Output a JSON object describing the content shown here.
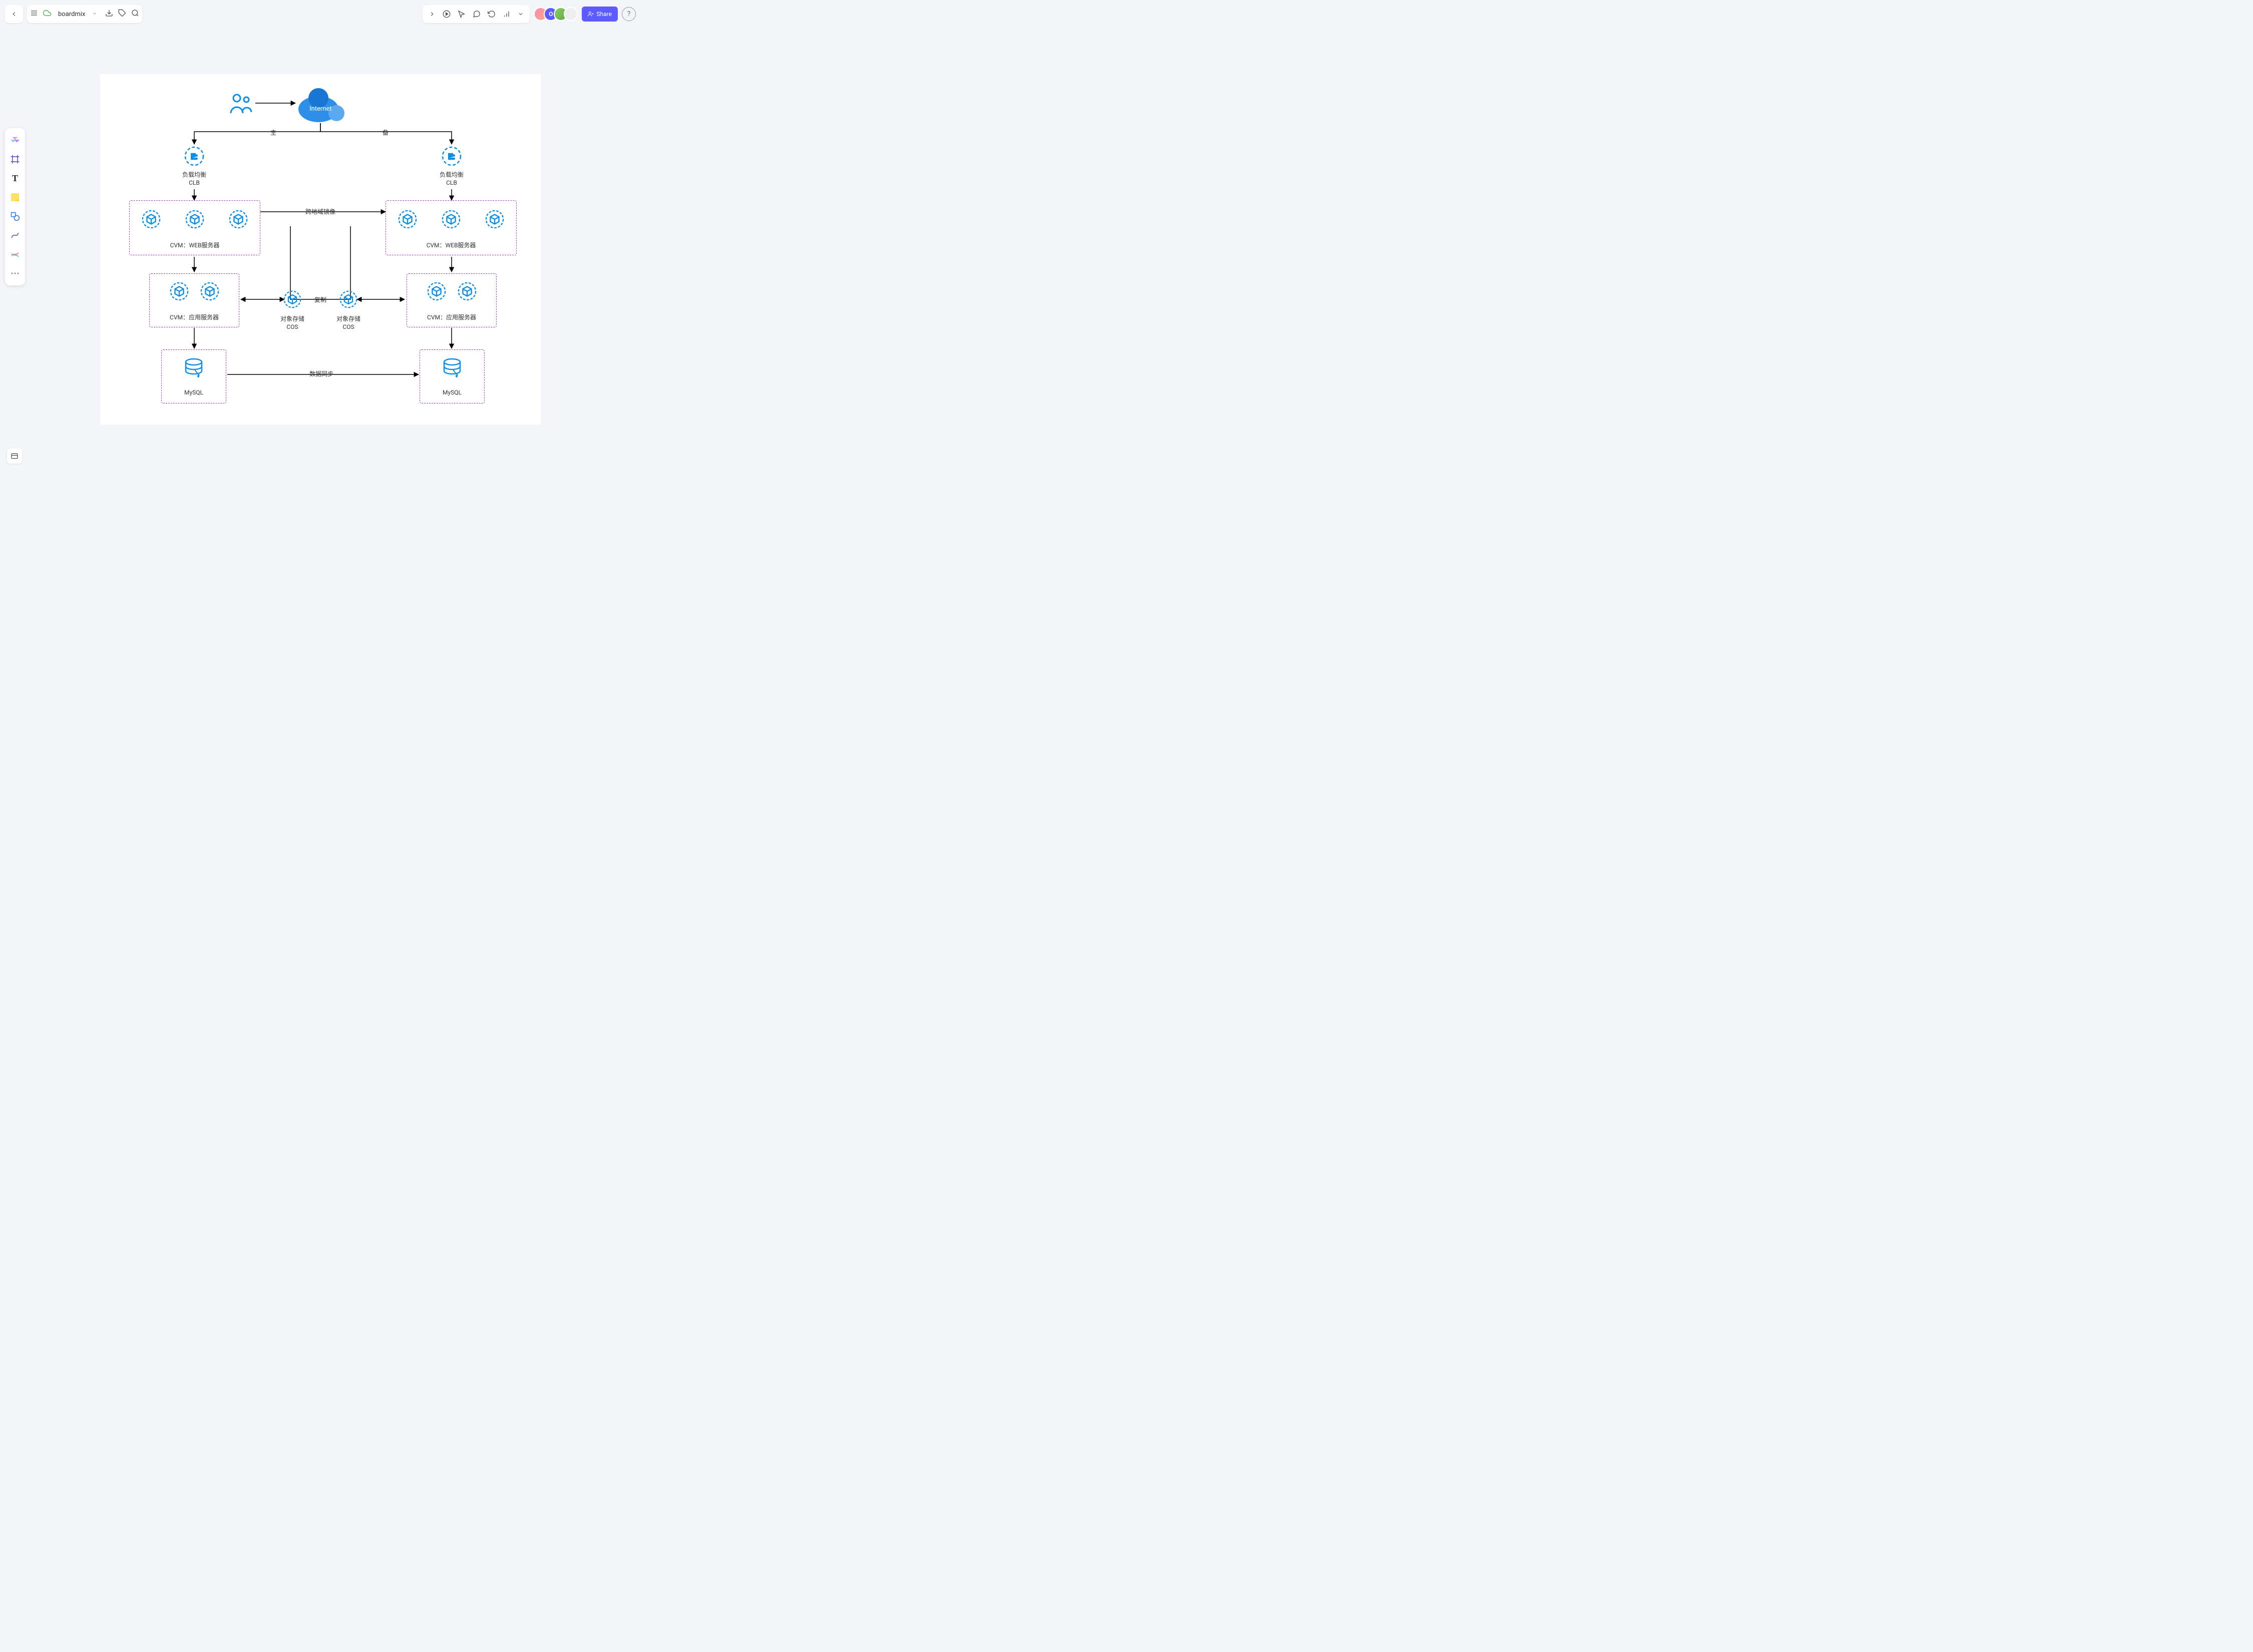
{
  "app": {
    "brand": "boardmix"
  },
  "header": {
    "share_label": "Share",
    "avatar_letter": "O"
  },
  "diagram": {
    "internet_label": "Internet",
    "primary_label": "主",
    "standby_label": "备",
    "clb_left_line1": "负载均衡",
    "clb_left_line2": "CLB",
    "clb_right_line1": "负载均衡",
    "clb_right_line2": "CLB",
    "web_left": "CVM：WEB服务器",
    "web_right": "CVM：WEB服务器",
    "cross_region": "跨地域镜像",
    "app_left": "CVM：应用服务器",
    "app_right": "CVM：应用服务器",
    "replicate": "复制",
    "cos_left_line1": "对象存储",
    "cos_left_line2": "COS",
    "cos_right_line1": "对象存储",
    "cos_right_line2": "COS",
    "mysql_left": "MySQL",
    "mysql_right": "MySQL",
    "data_sync": "数据同步"
  }
}
